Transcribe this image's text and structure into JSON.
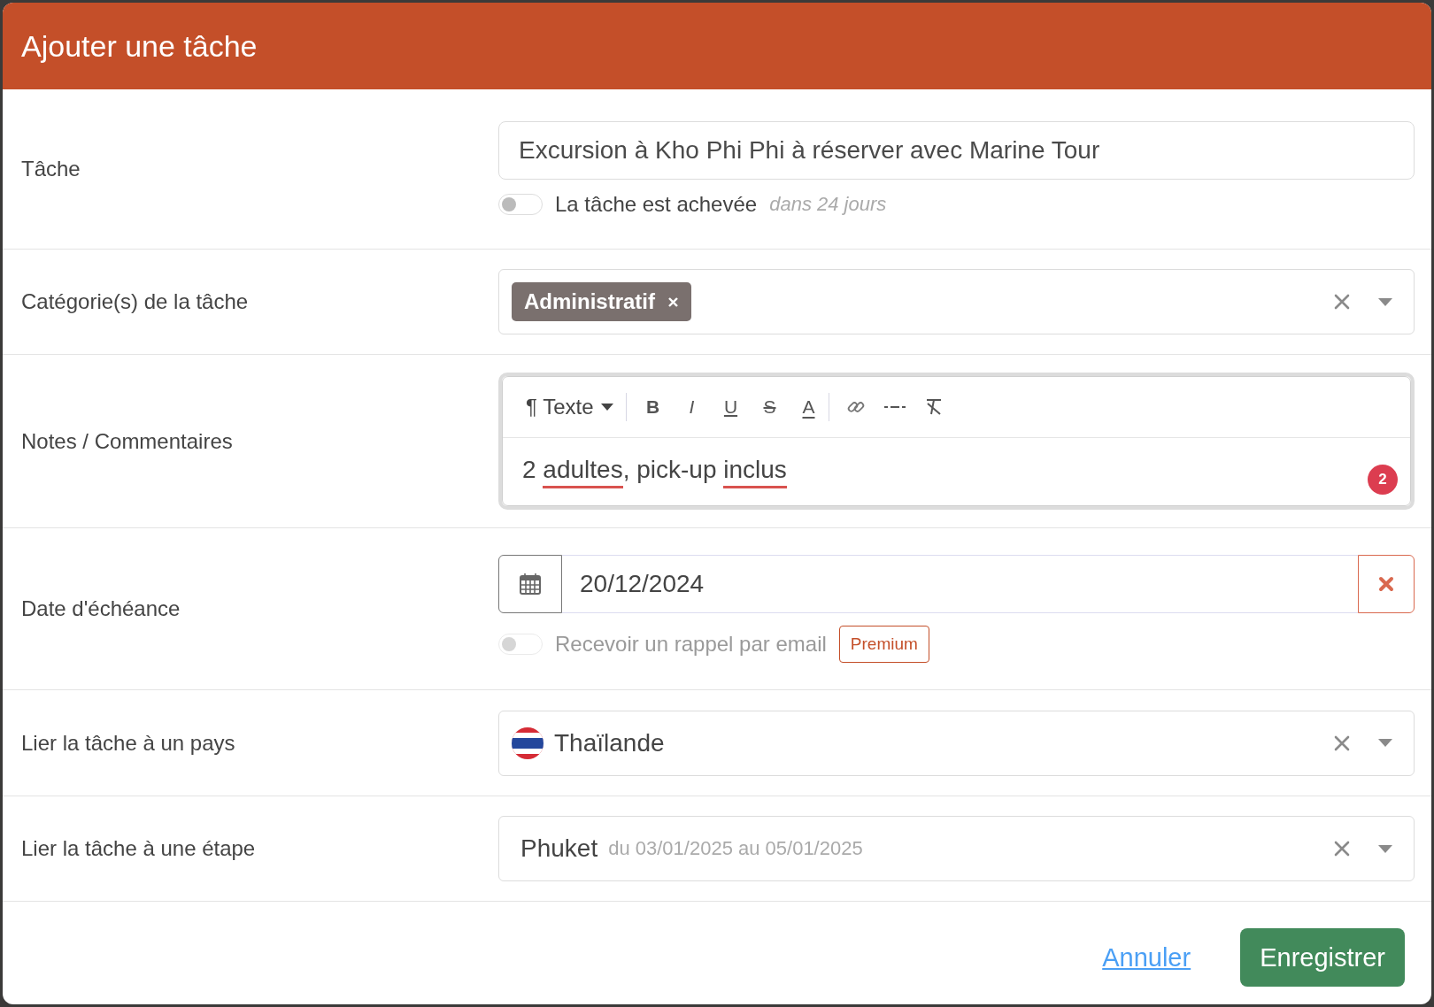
{
  "dialog": {
    "title": "Ajouter une tâche"
  },
  "fields": [
    {
      "kind": "text",
      "label": "Tâche",
      "value": "Excursion à Kho Phi Phi à réserver avec Marine Tour",
      "toggle": {
        "label": "La tâche est achevée",
        "on": false,
        "disabled": false,
        "hint": "dans 24 jours"
      }
    },
    {
      "kind": "tags",
      "label": "Catégorie(s) de la tâche",
      "tags": [
        "Administratif"
      ]
    },
    {
      "kind": "editor",
      "label": "Notes / Commentaires",
      "format": {
        "glyph": "¶",
        "label": "Texte"
      },
      "toolbar": [
        {
          "kind": "separator"
        },
        {
          "kind": "bold",
          "glyph": "B"
        },
        {
          "kind": "italic",
          "glyph": "I"
        },
        {
          "kind": "underline",
          "glyph": "U"
        },
        {
          "kind": "strike",
          "glyph": "S"
        },
        {
          "kind": "color",
          "glyph": "A"
        },
        {
          "kind": "separator"
        },
        {
          "kind": "link"
        },
        {
          "kind": "rule"
        },
        {
          "kind": "clear"
        }
      ],
      "segments": [
        {
          "text": "2 ",
          "flagged": false
        },
        {
          "text": "adultes",
          "flagged": true
        },
        {
          "text": ", pick-up ",
          "flagged": false
        },
        {
          "text": "inclus",
          "flagged": true
        }
      ],
      "issues": "2"
    },
    {
      "kind": "date",
      "label": "Date d'échéance",
      "value": "20/12/2024",
      "toggle": {
        "label": "Recevoir un rappel par email",
        "on": false,
        "disabled": true,
        "badge": "Premium"
      }
    },
    {
      "kind": "country",
      "label": "Lier la tâche à un pays",
      "value": "Thaïlande"
    },
    {
      "kind": "select",
      "label": "Lier la tâche à une étape",
      "value": "Phuket",
      "detail": "du 03/01/2025 au 05/01/2025"
    }
  ],
  "actions": [
    {
      "kind": "link",
      "label": "Annuler"
    },
    {
      "kind": "primary",
      "label": "Enregistrer"
    }
  ]
}
